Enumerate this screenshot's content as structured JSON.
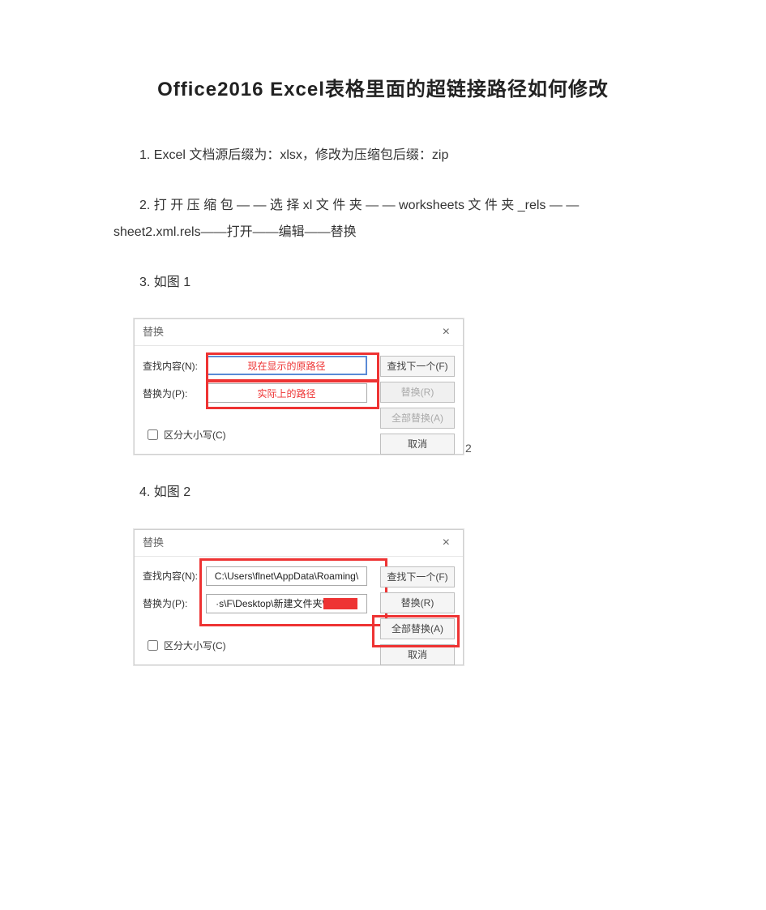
{
  "title": "Office2016  Excel表格里面的超链接路径如何修改",
  "steps": {
    "s1": "1. Excel 文档源后缀为：xlsx，修改为压缩包后缀：zip",
    "s2a": "2. 打 开 压 缩 包 — — 选 择  xl  文 件 夹 — — worksheets  文 件 夹 _rels — —",
    "s2b": "sheet2.xml.rels——打开——编辑——替换",
    "s3": "3. 如图 1",
    "s4": "4. 如图 2"
  },
  "dialog1": {
    "title": "替换",
    "findLabel": "查找内容(N):",
    "replaceLabel": "替换为(P):",
    "findValue": "现在显示的原路径",
    "replaceValue": "实际上的路径",
    "btnFindNext": "查找下一个(F)",
    "btnReplace": "替换(R)",
    "btnReplaceAll": "全部替换(A)",
    "btnCancel": "取消",
    "caseLabel": "区分大小写(C)",
    "captionNum": "2"
  },
  "dialog2": {
    "title": "替换",
    "findLabel": "查找内容(N):",
    "replaceLabel": "替换为(P):",
    "findValue": "C:\\Users\\flnet\\AppData\\Roaming\\",
    "replaceValuePrefix": "·s\\F\\Desktop\\新建文件夹\\",
    "btnFindNext": "查找下一个(F)",
    "btnReplace": "替换(R)",
    "btnReplaceAll": "全部替换(A)",
    "btnCancel": "取消",
    "caseLabel": "区分大小写(C)"
  }
}
